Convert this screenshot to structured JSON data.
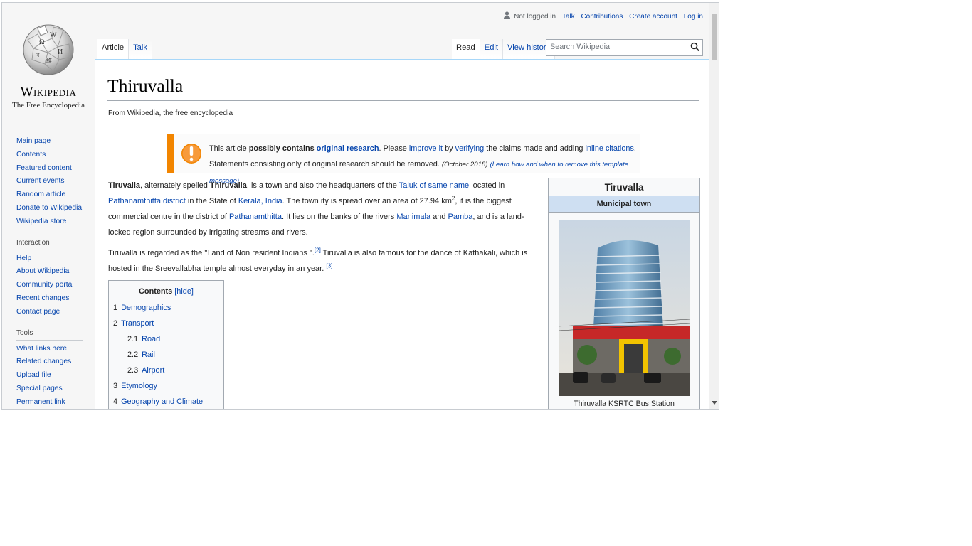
{
  "logo": {
    "wordmark": "Wikipedia",
    "tagline": "The Free Encyclopedia"
  },
  "personal": {
    "not_logged_in": "Not logged in",
    "talk": "Talk",
    "contributions": "Contributions",
    "create_account": "Create account",
    "log_in": "Log in"
  },
  "tabs": {
    "article": "Article",
    "talk": "Talk",
    "read": "Read",
    "edit": "Edit",
    "view_history": "View history"
  },
  "search": {
    "placeholder": "Search Wikipedia"
  },
  "sidebar": {
    "navigation": [
      "Main page",
      "Contents",
      "Featured content",
      "Current events",
      "Random article",
      "Donate to Wikipedia",
      "Wikipedia store"
    ],
    "interaction_heading": "Interaction",
    "interaction": [
      "Help",
      "About Wikipedia",
      "Community portal",
      "Recent changes",
      "Contact page"
    ],
    "tools_heading": "Tools",
    "tools": [
      "What links here",
      "Related changes",
      "Upload file",
      "Special pages",
      "Permanent link"
    ]
  },
  "article": {
    "title": "Thiruvalla",
    "site_sub": "From Wikipedia, the free encyclopedia",
    "ambox": {
      "t1": "This article ",
      "t2": "possibly contains ",
      "t3": "original research",
      "t4": ". Please ",
      "t5": "improve it",
      "t6": " by ",
      "t7": "verifying",
      "t8": " the claims made and adding ",
      "t9": "inline citations",
      "t10": ".",
      "t11": "Statements consisting only of original research should be removed. ",
      "t12": "(October 2018)",
      "t13": "(Learn how and when to remove this template message)"
    },
    "p1": {
      "a": "Tiruvalla",
      "b": ", alternately spelled ",
      "c": "Thiruvalla",
      "d": ", is a town and also the headquarters of the ",
      "e": "Taluk of same name",
      "f": " located in ",
      "g": "Pathanamthitta district",
      "h": " in the State of ",
      "i": "Kerala",
      "j": ", ",
      "k": "India",
      "l": ". The town ity is spread over an area of 27.94 km",
      "m": "2",
      "n": ", it is the biggest commercial centre in the district of ",
      "o": "Pathanamthitta",
      "p": ". It lies on the banks of the rivers ",
      "q": "Manimala",
      "r": " and ",
      "s": "Pamba",
      "t": ", and is a land-locked region surrounded by irrigating streams and rivers."
    },
    "p2": {
      "a": "Tiruvalla is regarded as the \"Land of Non resident Indians \".",
      "b": "[2]",
      "c": " Tiruvalla is also famous for the dance of Kathakali, which is hosted in the Sreevallabha temple almost everyday in an year. ",
      "d": "[3]"
    }
  },
  "toc": {
    "title": "Contents",
    "hide": "[hide]",
    "items": [
      {
        "num": "1",
        "label": "Demographics"
      },
      {
        "num": "2",
        "label": "Transport"
      },
      {
        "num": "2.1",
        "label": "Road"
      },
      {
        "num": "2.2",
        "label": "Rail"
      },
      {
        "num": "2.3",
        "label": "Airport"
      },
      {
        "num": "3",
        "label": "Etymology"
      },
      {
        "num": "4",
        "label": "Geography and Climate"
      }
    ]
  },
  "infobox": {
    "title": "Tiruvalla",
    "subtitle": "Municipal town",
    "caption": "Thiruvalla KSRTC Bus Station"
  },
  "colors": {
    "link": "#0645ad",
    "ambox_accent": "#f28500",
    "infobox_subheader": "#cedff2"
  }
}
